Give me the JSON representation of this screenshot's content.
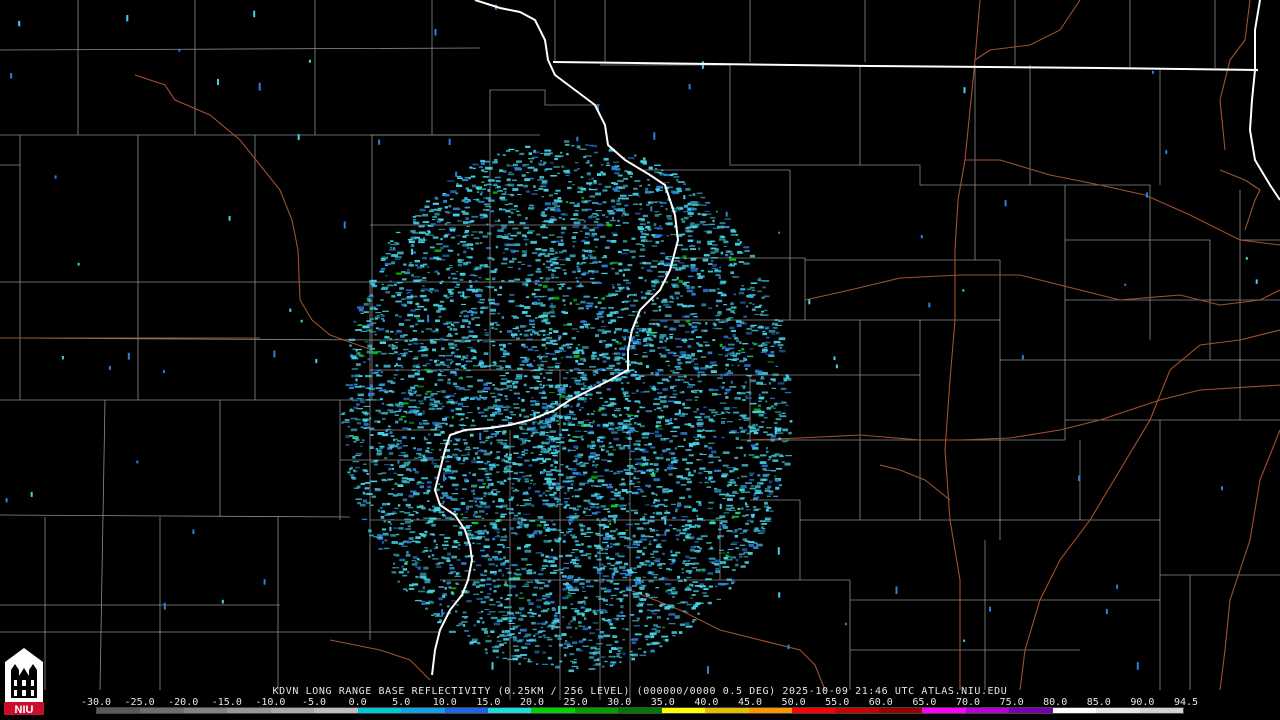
{
  "product_header": "KDVN LONG RANGE BASE REFLECTIVITY (0.25KM / 256 LEVEL) (000000/0000 0.5 DEG) 2025-10-09 21:46 UTC  ATLAS.NIU.EDU",
  "scale_labels": [
    "-30.0",
    "-25.0",
    "-20.0",
    "-15.0",
    "-10.0",
    "-5.0",
    "0.0",
    "5.0",
    "10.0",
    "15.0",
    "20.0",
    "25.0",
    "30.0",
    "35.0",
    "40.0",
    "45.0",
    "50.0",
    "55.0",
    "60.0",
    "65.0",
    "70.0",
    "75.0",
    "80.0",
    "85.0",
    "90.0",
    "94.5"
  ],
  "logo_text": "NIU",
  "colors": {
    "background": "#000000",
    "state_border": "#ffffff",
    "county_line": "#8c8c8c",
    "highway": "#a0522d",
    "echo_primary": "#46d2e6",
    "echo_secondary": "#2a7fe0"
  },
  "colorbar_colors": [
    "#5a5a5a",
    "#6e6e6e",
    "#828282",
    "#969696",
    "#aaaaaa",
    "#bebebe",
    "#00c8d2",
    "#12a0e6",
    "#1e64e6",
    "#1edcdc",
    "#00d200",
    "#00a000",
    "#007800",
    "#ffff00",
    "#e6be00",
    "#ff9600",
    "#ff0000",
    "#c80000",
    "#960000",
    "#ff00ff",
    "#b400d2",
    "#7800b4",
    "#ffffff",
    "#e6e6e6",
    "#d2d2d2"
  ]
}
